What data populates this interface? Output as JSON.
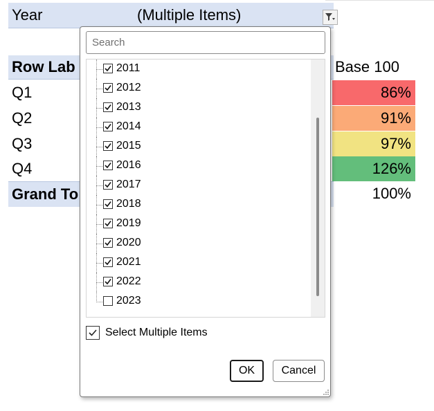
{
  "pivot": {
    "filter_field": "Year",
    "filter_value": "(Multiple Items)",
    "row_labels_header": "Row Lab",
    "value_header": "Base 100",
    "rows": [
      {
        "label": "Q1",
        "value": "86%",
        "color": "#f8696b"
      },
      {
        "label": "Q2",
        "value": "91%",
        "color": "#fbaa77"
      },
      {
        "label": "Q3",
        "value": "97%",
        "color": "#f1e382"
      },
      {
        "label": "Q4",
        "value": "126%",
        "color": "#63be7b"
      }
    ],
    "grand_total_label": "Grand To",
    "grand_total_value": "100%"
  },
  "icons": {
    "filter_button": "filter-funnel-icon",
    "item_check": "checkmark-icon",
    "resize": "resize-grip-icon"
  },
  "dropdown": {
    "search_placeholder": "Search",
    "items": [
      {
        "label": "2011",
        "checked": true
      },
      {
        "label": "2012",
        "checked": true
      },
      {
        "label": "2013",
        "checked": true
      },
      {
        "label": "2014",
        "checked": true
      },
      {
        "label": "2015",
        "checked": true
      },
      {
        "label": "2016",
        "checked": true
      },
      {
        "label": "2017",
        "checked": true
      },
      {
        "label": "2018",
        "checked": true
      },
      {
        "label": "2019",
        "checked": true
      },
      {
        "label": "2020",
        "checked": true
      },
      {
        "label": "2021",
        "checked": true
      },
      {
        "label": "2022",
        "checked": true
      },
      {
        "label": "2023",
        "checked": false
      }
    ],
    "select_multiple_label": "Select Multiple Items",
    "select_multiple_checked": true,
    "ok_label": "OK",
    "cancel_label": "Cancel"
  }
}
